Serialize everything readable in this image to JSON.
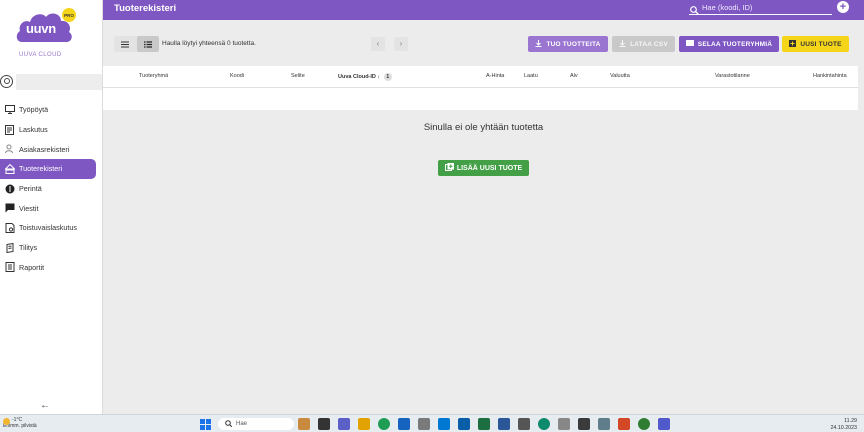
{
  "brand": {
    "logo_text": "uuvn",
    "pro_badge": "PRO",
    "subtitle": "UUVA CLOUD"
  },
  "sidebar": {
    "items": [
      {
        "label": "Työpöytä",
        "icon": "monitor-icon"
      },
      {
        "label": "Laskutus",
        "icon": "invoice-icon"
      },
      {
        "label": "Asiakasrekisteri",
        "icon": "customers-icon"
      },
      {
        "label": "Tuoterekisteri",
        "icon": "product-register-icon",
        "active": true
      },
      {
        "label": "Perintä",
        "icon": "collection-icon"
      },
      {
        "label": "Viestit",
        "icon": "messages-icon"
      },
      {
        "label": "Toistuvaislaskutus",
        "icon": "recurring-icon"
      },
      {
        "label": "Tilitys",
        "icon": "settlement-icon"
      },
      {
        "label": "Raportit",
        "icon": "reports-icon"
      }
    ],
    "collapse_glyph": "←"
  },
  "header": {
    "title": "Tuoterekisteri",
    "search_placeholder": "Hae (koodi, ID)"
  },
  "toolbar": {
    "results_text": "Haulla löytyi yhteensä 0 tuotetta.",
    "prev_glyph": "‹",
    "next_glyph": "›",
    "import_label": "TUO TUOTTEITA",
    "csv_label": "LATAA CSV",
    "groups_label": "SELAA TUOTERYHMIÄ",
    "new_label": "UUSI TUOTE"
  },
  "table": {
    "columns": [
      {
        "label": "Tuoteryhmä"
      },
      {
        "label": "Koodi"
      },
      {
        "label": "Selite"
      },
      {
        "label": "Uuva Cloud-ID",
        "sorted": true,
        "sort_dir": "↓",
        "sort_order": "1"
      },
      {
        "label": "A-Hinta"
      },
      {
        "label": "Laatu"
      },
      {
        "label": "Alv"
      },
      {
        "label": "Valuutta"
      },
      {
        "label": "Varastotilanne"
      },
      {
        "label": "Hankintahinta"
      }
    ],
    "rows": []
  },
  "empty_state": {
    "message": "Sinulla ei ole yhtään tuotetta",
    "add_label": "LISÄÄ UUSI TUOTE"
  },
  "taskbar": {
    "weather_temp": "-1°C",
    "weather_desc": "Enimm. pilvistä",
    "search_label": "Hae",
    "time": "11.29",
    "date": "24.10.2023"
  },
  "colors": {
    "brand_purple": "#7e57c2",
    "accent_yellow": "#f5d51a",
    "success_green": "#43a047"
  }
}
